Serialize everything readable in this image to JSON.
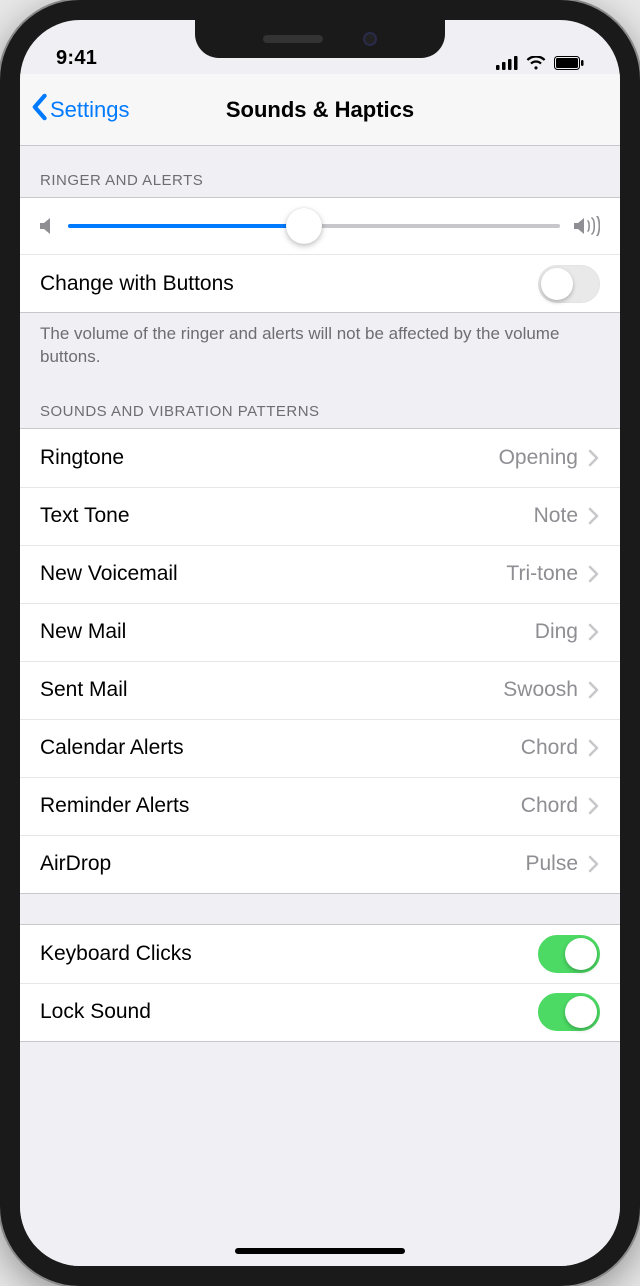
{
  "statusbar": {
    "time": "9:41"
  },
  "navbar": {
    "back": "Settings",
    "title": "Sounds & Haptics"
  },
  "ringer": {
    "header": "RINGER AND ALERTS",
    "change_label": "Change with Buttons",
    "change_on": false,
    "slider_percent": 48,
    "footer": "The volume of the ringer and alerts will not be affected by the volume buttons."
  },
  "patterns": {
    "header": "SOUNDS AND VIBRATION PATTERNS",
    "items": [
      {
        "label": "Ringtone",
        "value": "Opening"
      },
      {
        "label": "Text Tone",
        "value": "Note"
      },
      {
        "label": "New Voicemail",
        "value": "Tri-tone"
      },
      {
        "label": "New Mail",
        "value": "Ding"
      },
      {
        "label": "Sent Mail",
        "value": "Swoosh"
      },
      {
        "label": "Calendar Alerts",
        "value": "Chord"
      },
      {
        "label": "Reminder Alerts",
        "value": "Chord"
      },
      {
        "label": "AirDrop",
        "value": "Pulse"
      }
    ]
  },
  "clicks": {
    "items": [
      {
        "label": "Keyboard Clicks",
        "on": true
      },
      {
        "label": "Lock Sound",
        "on": true
      }
    ]
  }
}
